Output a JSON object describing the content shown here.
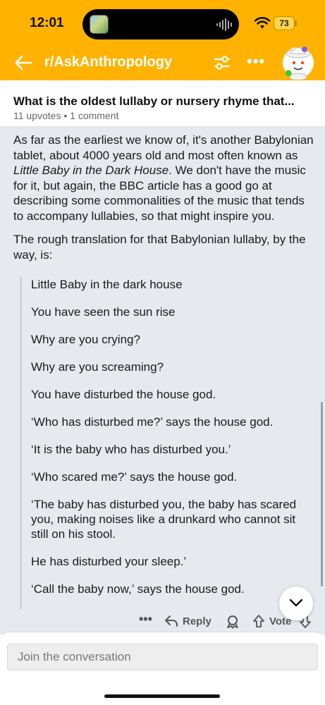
{
  "status_bar": {
    "time": "12:01",
    "battery": "73"
  },
  "nav": {
    "subreddit": "r/AskAnthropology",
    "more": "•••"
  },
  "post": {
    "title": "What is the oldest lullaby or nursery rhyme that...",
    "meta": "11 upvotes • 1 comment"
  },
  "comment": {
    "p1_before_italic": "As far as the earliest we know of, it's another Babylonian tablet, about 4000 years old and most often known as ",
    "p1_italic": "Little Baby in the Dark House",
    "p1_after_italic": ". We don't have the music for it, but again, the BBC article has a good go at describing some commonalities of the music that tends to accompany lullabies, so that might inspire you.",
    "p2": "The rough translation for that Babylonian lullaby, by the way, is:",
    "quote_lines": [
      "Little Baby in the dark house",
      "You have seen the sun rise",
      "Why are you crying?",
      "Why are you screaming?",
      "You have disturbed the house god.",
      "‘Who has disturbed me?’ says the house god.",
      "‘It is the baby who has disturbed you.’",
      "‘Who scared me?’ says the house god.",
      "‘The baby has disturbed you, the baby has scared you, making noises like a drunkard who cannot sit still on his stool.",
      "He has disturbed your sleep.’",
      "‘Call the baby now,’ says the house god."
    ]
  },
  "actions": {
    "more": "•••",
    "reply": "Reply",
    "vote": "Vote"
  },
  "composer": {
    "placeholder": "Join the conversation"
  },
  "colors": {
    "header_bg": "#ffb300",
    "comment_bg": "#e6eaee"
  }
}
